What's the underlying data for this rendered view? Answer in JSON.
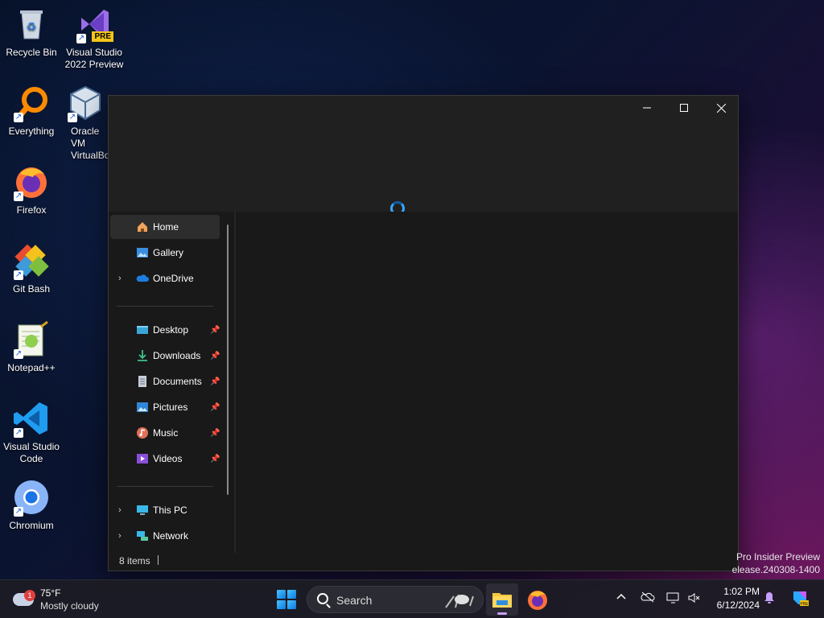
{
  "desktop": {
    "icons": [
      {
        "label": "Recycle Bin"
      },
      {
        "label": "Visual Studio 2022 Preview",
        "badge": "PRE"
      },
      {
        "label": "Everything"
      },
      {
        "label": "Oracle VM VirtualBox"
      },
      {
        "label": "Firefox"
      },
      {
        "label": "Git Bash"
      },
      {
        "label": "Notepad++"
      },
      {
        "label": "Visual Studio Code"
      },
      {
        "label": "Chromium"
      }
    ]
  },
  "explorer": {
    "nav": {
      "home": "Home",
      "gallery": "Gallery",
      "onedrive": "OneDrive",
      "desktop": "Desktop",
      "downloads": "Downloads",
      "documents": "Documents",
      "pictures": "Pictures",
      "music": "Music",
      "videos": "Videos",
      "thispc": "This PC",
      "network": "Network"
    },
    "status": "8 items"
  },
  "watermark": {
    "line1": "Pro Insider Preview",
    "line2": "elease.240308-1400"
  },
  "taskbar": {
    "weather_temp": "75°F",
    "weather_desc": "Mostly cloudy",
    "weather_badge": "1",
    "search_label": "Search",
    "time": "1:02 PM",
    "date": "6/12/2024"
  },
  "colors": {
    "accent": "#3aa7ff",
    "window_bg": "#191919",
    "titlebar_bg": "#202020"
  }
}
